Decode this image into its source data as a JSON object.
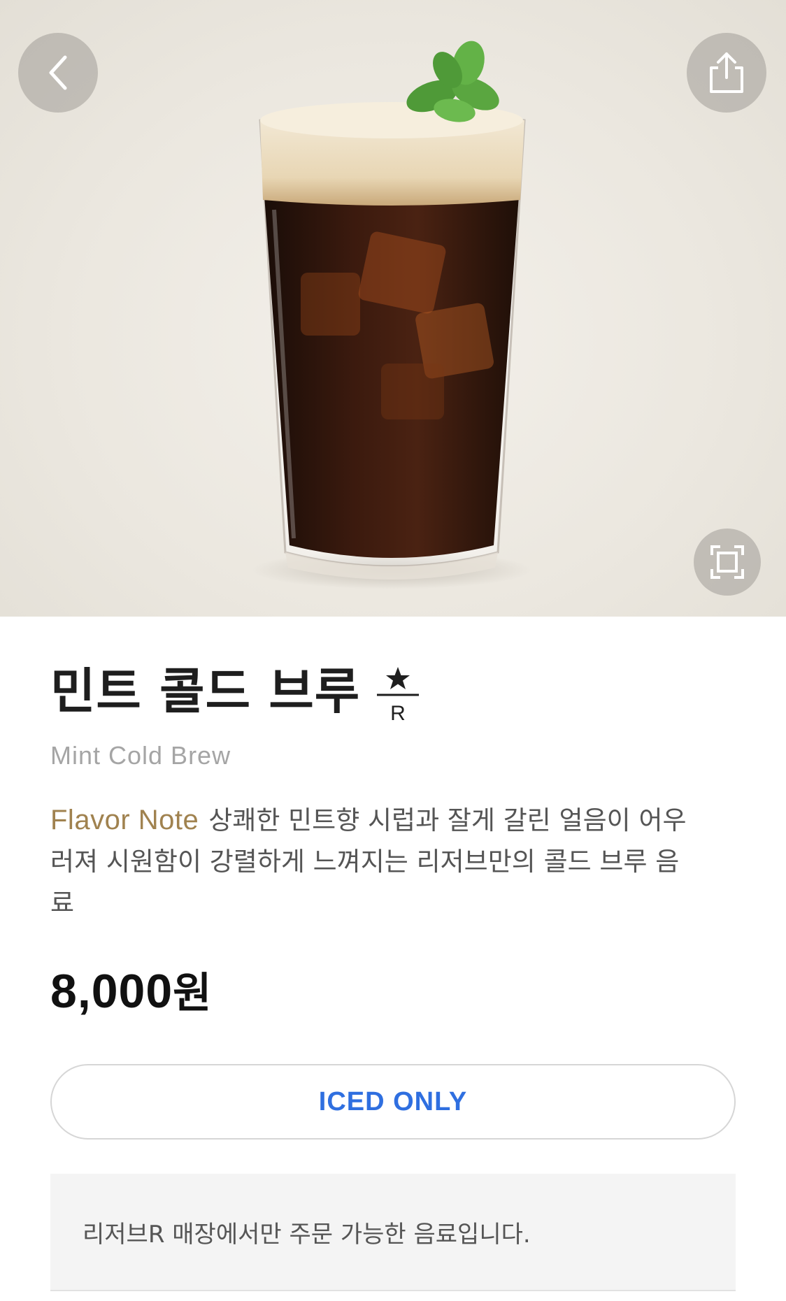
{
  "product": {
    "name_ko": "민트 콜드 브루",
    "name_en": "Mint Cold Brew",
    "reserve_mark_letter": "R",
    "flavor_label": "Flavor Note",
    "description": "상쾌한 민트향 시럽과 잘게 갈린 얼음이 어우러져 시원함이 강렬하게 느껴지는 리저브만의 콜드 브루 음료",
    "price_number": "8,000",
    "price_unit": "원",
    "temperature_option": "ICED ONLY",
    "notice": "리저브R 매장에서만 주문 가능한 음료입니다."
  },
  "icons": {
    "back": "chevron-left-icon",
    "share": "share-icon",
    "zoom": "fullscreen-icon",
    "reserve": "reserve-star-icon"
  },
  "colors": {
    "flavor_accent": "#a0824f",
    "iced_text": "#2f6fe0",
    "subtitle": "#a5a5a5"
  }
}
